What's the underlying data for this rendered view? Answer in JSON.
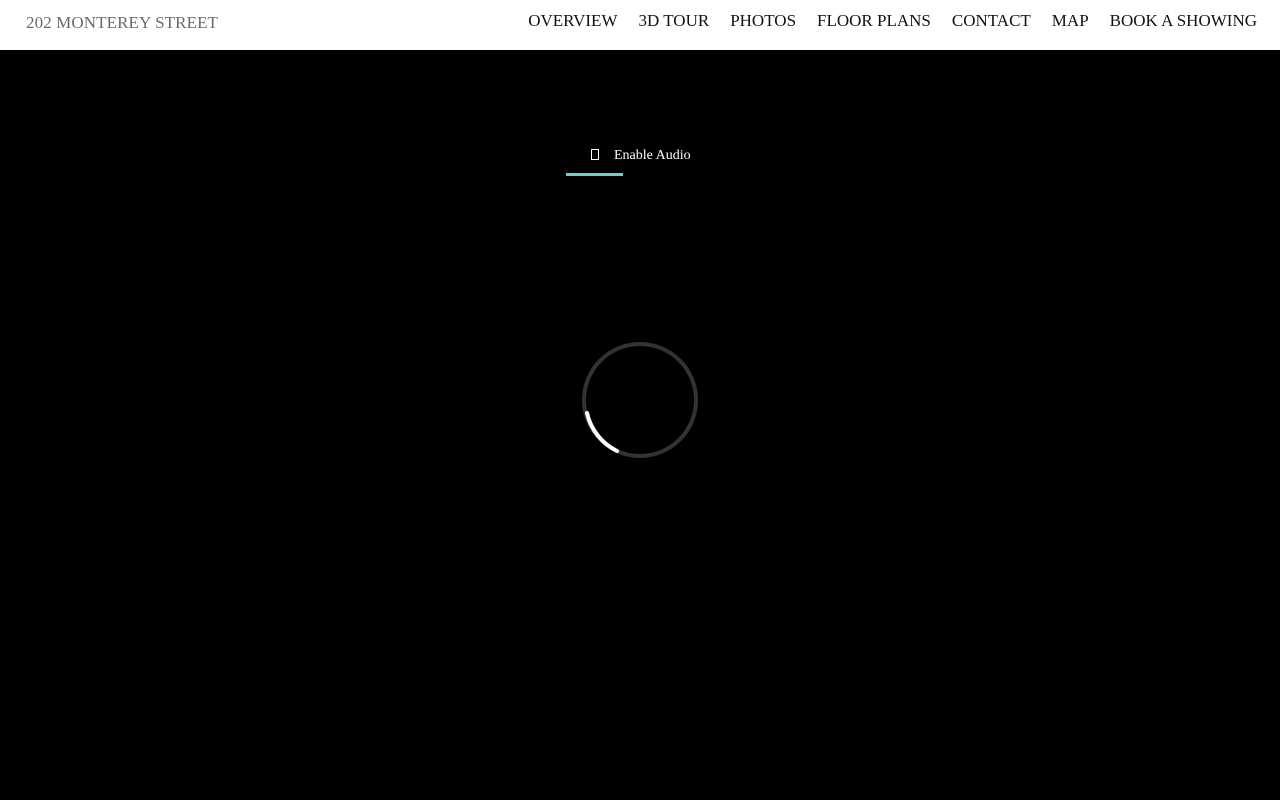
{
  "header": {
    "site_title": "202 MONTEREY STREET",
    "nav": [
      {
        "label": "OVERVIEW"
      },
      {
        "label": "3D TOUR"
      },
      {
        "label": "PHOTOS"
      },
      {
        "label": "FLOOR PLANS"
      },
      {
        "label": "CONTACT"
      },
      {
        "label": "MAP"
      },
      {
        "label": "BOOK A SHOWING"
      }
    ]
  },
  "viewer": {
    "audio_button": {
      "label": "Enable Audio",
      "icon": "speaker-icon",
      "accent_color": "#6fcdd0"
    },
    "loading_spinner": {
      "icon": "loading-spinner-icon"
    }
  },
  "colors": {
    "header_bg": "#ffffff",
    "viewer_bg": "#000000",
    "accent": "#6fcdd0"
  }
}
